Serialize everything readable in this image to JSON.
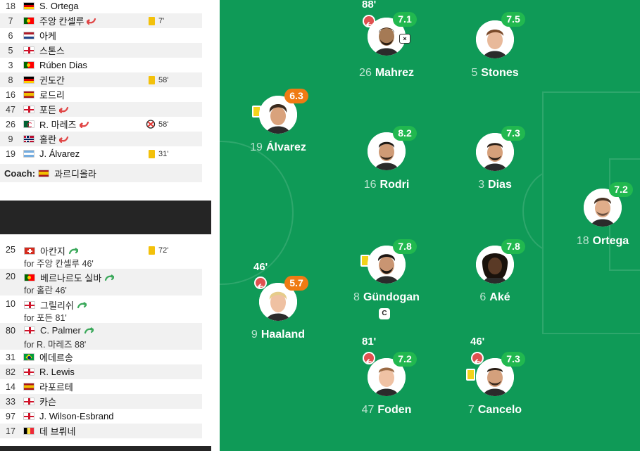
{
  "lineup": [
    {
      "num": "18",
      "flag": "de",
      "name": "S. Ortega"
    },
    {
      "num": "7",
      "flag": "pt",
      "name": "주앙 칸셀루",
      "sub_out": true,
      "yellow_card": true,
      "minute": "7'"
    },
    {
      "num": "6",
      "flag": "nl",
      "name": "아케"
    },
    {
      "num": "5",
      "flag": "en",
      "name": "스톤스"
    },
    {
      "num": "3",
      "flag": "pt",
      "name": "Rúben Dias"
    },
    {
      "num": "8",
      "flag": "de",
      "name": "귄도간",
      "yellow_card": true,
      "minute": "58'"
    },
    {
      "num": "16",
      "flag": "es",
      "name": "로드리"
    },
    {
      "num": "47",
      "flag": "en",
      "name": "포든",
      "sub_out": true
    },
    {
      "num": "26",
      "flag": "dz",
      "name": "R. 마레즈",
      "sub_out": true,
      "missed_penalty": true,
      "minute": "58'"
    },
    {
      "num": "9",
      "flag": "no",
      "name": "홀란",
      "sub_out": true
    },
    {
      "num": "19",
      "flag": "ar",
      "name": "J. Álvarez",
      "yellow_card": true,
      "minute": "31'"
    }
  ],
  "coach": {
    "label": "Coach:",
    "flag": "es",
    "name": "과르디올라"
  },
  "subs_in": [
    {
      "num": "25",
      "flag": "ch",
      "name": "아칸지",
      "for": "for 주앙 칸셀루 46'",
      "yellow_card": true,
      "minute": "72'"
    },
    {
      "num": "20",
      "flag": "pt",
      "name": "베르나르도 실바",
      "for": "for 홀란 46'"
    },
    {
      "num": "10",
      "flag": "en",
      "name": "그릴리쉬",
      "for": "for 포든 81'"
    },
    {
      "num": "80",
      "flag": "en",
      "name": "C. Palmer",
      "for": "for R. 마레즈 88'"
    }
  ],
  "bench": [
    {
      "num": "31",
      "flag": "br",
      "name": "에데르송"
    },
    {
      "num": "82",
      "flag": "en",
      "name": "R. Lewis"
    },
    {
      "num": "14",
      "flag": "es",
      "name": "라포르테"
    },
    {
      "num": "33",
      "flag": "en",
      "name": "카슨"
    },
    {
      "num": "97",
      "flag": "en",
      "name": "J. Wilson-Esbrand"
    },
    {
      "num": "17",
      "flag": "be",
      "name": "데 브뤼네"
    }
  ],
  "pitch_players": [
    {
      "id": "mahrez",
      "num": "26",
      "name": "Mahrez",
      "rating": "7.1",
      "rating_color": "green",
      "sub_minute": "88'",
      "missed_penalty": true
    },
    {
      "id": "stones",
      "num": "5",
      "name": "Stones",
      "rating": "7.5",
      "rating_color": "green"
    },
    {
      "id": "alvarez",
      "num": "19",
      "name": "Álvarez",
      "rating": "6.3",
      "rating_color": "orange",
      "yellow_card": true
    },
    {
      "id": "rodri",
      "num": "16",
      "name": "Rodri",
      "rating": "8.2",
      "rating_color": "green"
    },
    {
      "id": "dias",
      "num": "3",
      "name": "Dias",
      "rating": "7.3",
      "rating_color": "green"
    },
    {
      "id": "ortega",
      "num": "18",
      "name": "Ortega",
      "rating": "7.2",
      "rating_color": "green"
    },
    {
      "id": "haaland",
      "num": "9",
      "name": "Haaland",
      "rating": "5.7",
      "rating_color": "orange",
      "sub_minute": "46'"
    },
    {
      "id": "gundogan",
      "num": "8",
      "name": "Gündogan",
      "rating": "7.8",
      "rating_color": "green",
      "yellow_card": true,
      "captain": "C"
    },
    {
      "id": "ake",
      "num": "6",
      "name": "Aké",
      "rating": "7.8",
      "rating_color": "green"
    },
    {
      "id": "foden",
      "num": "47",
      "name": "Foden",
      "rating": "7.2",
      "rating_color": "green",
      "sub_minute": "81'"
    },
    {
      "id": "cancelo",
      "num": "7",
      "name": "Cancelo",
      "rating": "7.3",
      "rating_color": "green",
      "sub_minute": "46'",
      "yellow_card": true
    }
  ],
  "missed_penalty_symbol": "×",
  "colors": {
    "pitch": "#0f9a57",
    "rating_green": "#21b84f",
    "rating_orange": "#ef7b14",
    "yellow_card": "#f3c10b",
    "sub_out": "#e05050",
    "sub_in": "#2e9e4f"
  }
}
